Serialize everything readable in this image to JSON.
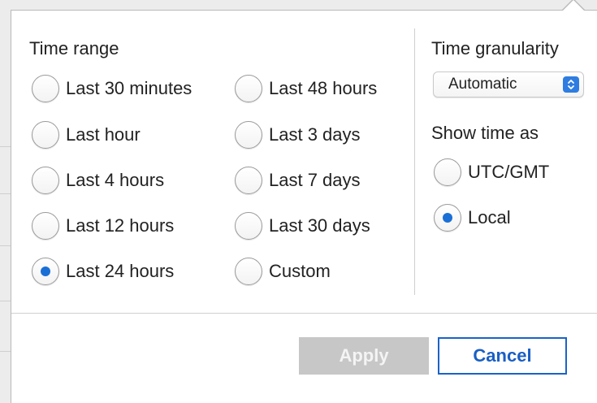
{
  "time_range": {
    "title": "Time range",
    "options": [
      {
        "label": "Last 30 minutes",
        "checked": false
      },
      {
        "label": "Last hour",
        "checked": false
      },
      {
        "label": "Last 4 hours",
        "checked": false
      },
      {
        "label": "Last 12 hours",
        "checked": false
      },
      {
        "label": "Last 24 hours",
        "checked": true
      },
      {
        "label": "Last 48 hours",
        "checked": false
      },
      {
        "label": "Last 3 days",
        "checked": false
      },
      {
        "label": "Last 7 days",
        "checked": false
      },
      {
        "label": "Last 30 days",
        "checked": false
      },
      {
        "label": "Custom",
        "checked": false
      }
    ]
  },
  "granularity": {
    "title": "Time granularity",
    "selected": "Automatic"
  },
  "show_time_as": {
    "title": "Show time as",
    "options": [
      {
        "label": "UTC/GMT",
        "checked": false
      },
      {
        "label": "Local",
        "checked": true
      }
    ]
  },
  "actions": {
    "apply_label": "Apply",
    "apply_enabled": false,
    "cancel_label": "Cancel"
  },
  "colors": {
    "accent": "#1a6fd6",
    "disabled_button": "#c7c7c7"
  },
  "icons": {
    "select_stepper": "up-down-chevron-icon",
    "popover_caret": "popover-arrow"
  }
}
